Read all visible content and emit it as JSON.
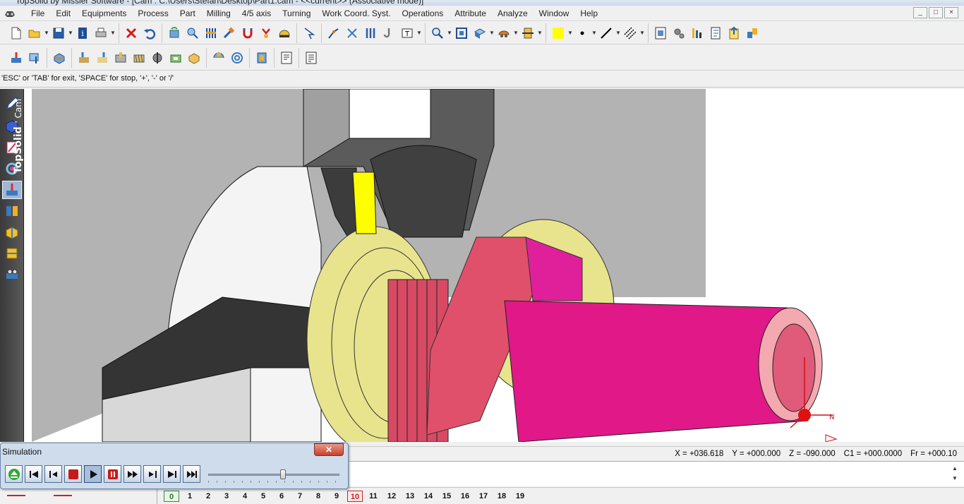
{
  "titlebar": {
    "title": "TopSolid by Missler Software - [Cam : C:\\Users\\Stefan\\Desktop\\Part1.cam - <<current>> (Associative mode)]"
  },
  "menu": {
    "items": [
      "File",
      "Edit",
      "Equipments",
      "Process",
      "Part",
      "Milling",
      "4/5 axis",
      "Turning",
      "Work Coord. Syst.",
      "Operations",
      "Attribute",
      "Analyze",
      "Window",
      "Help"
    ]
  },
  "window_controls": [
    "_",
    "□",
    "×"
  ],
  "prompt": {
    "text": "'ESC' or 'TAB' for exit, 'SPACE' for stop, '+', '-' or '/'"
  },
  "brand": {
    "name": "TopSolid",
    "suffix": "' Cam"
  },
  "colors": {
    "highlight_yellow": "#ffff00",
    "part_pink": "#e0208a",
    "stock_yellow": "#e8e48e",
    "tool_gray": "#9c9c9c"
  },
  "simulation": {
    "title": "Simulation",
    "close_label": "✕",
    "slider_level": 0.57,
    "buttons": [
      "eject-icon",
      "first-icon",
      "step-back-icon",
      "stop-icon",
      "play-icon",
      "pause-icon",
      "fast-forward-icon",
      "step-forward-icon",
      "next-icon",
      "last-icon"
    ]
  },
  "status": {
    "x": "X = +036.618",
    "y": "Y = +000.000",
    "z": "Z = -090.000",
    "c1": "C1 = +000.0000",
    "fr": "Fr = +000.10"
  },
  "pages": {
    "items": [
      "0",
      "1",
      "2",
      "3",
      "4",
      "5",
      "6",
      "7",
      "8",
      "9",
      "10",
      "11",
      "12",
      "13",
      "14",
      "15",
      "16",
      "17",
      "18",
      "19"
    ],
    "current": "10"
  }
}
